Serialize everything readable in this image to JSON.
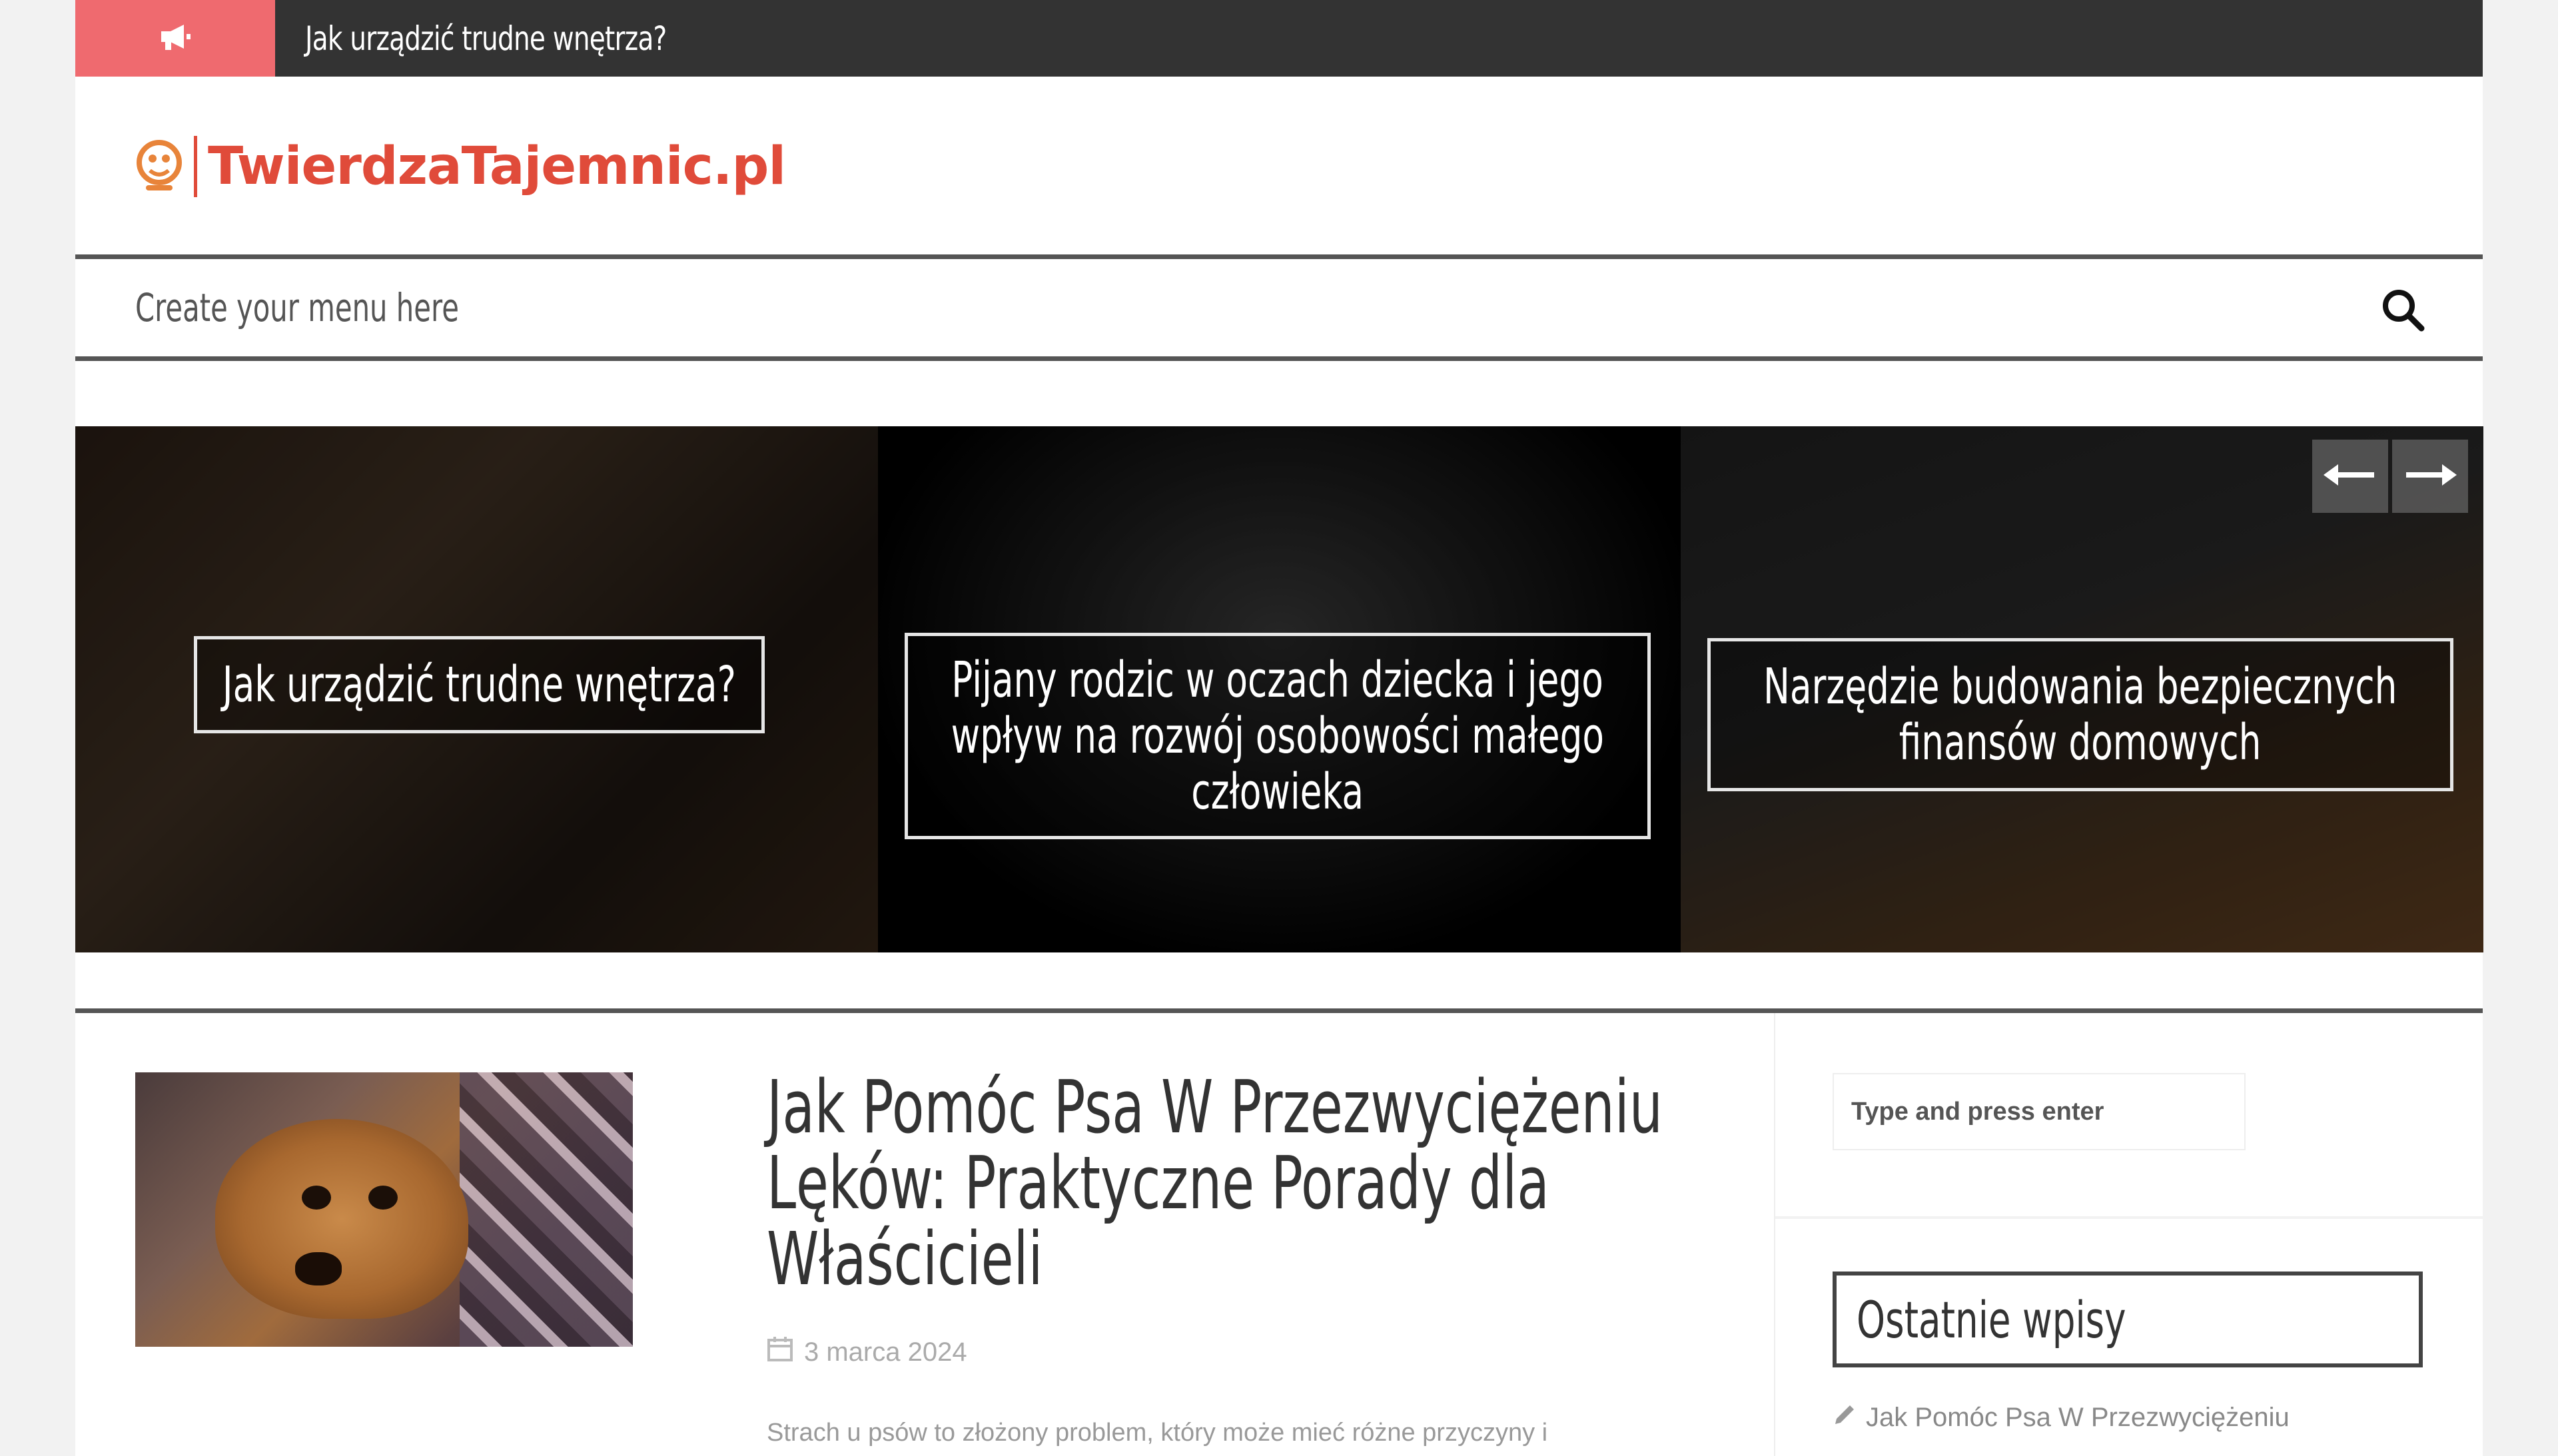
{
  "topbar": {
    "headline": "Jak urządzić trudne wnętrza?"
  },
  "logo": {
    "text": "TwierdzaTajemnic.pl"
  },
  "nav": {
    "menu_text": "Create your menu here"
  },
  "slider": {
    "slides": [
      {
        "title": "Jak urządzić trudne wnętrza?"
      },
      {
        "title_lines": [
          "Pijany rodzic w oczach dziecka i jego",
          "wpływ na rozwój osobowości małego",
          "człowieka"
        ]
      },
      {
        "title_lines": [
          "Narzędzie budowania bezpiecznych",
          "finansów domowych"
        ]
      }
    ]
  },
  "article": {
    "title_lines": [
      "Jak Pomóc Psa W Przezwyciężeniu",
      "Lęków: Praktyczne Porady dla",
      "Właścicieli"
    ],
    "date": "3 marca 2024",
    "excerpt": "Strach u psów to złożony problem, który może mieć różne przyczyny i"
  },
  "sidebar": {
    "search_placeholder": "Type and press enter",
    "widget_title": "Ostatnie wpisy",
    "recent_posts": [
      "Jak Pomóc Psa W Przezwyciężeniu"
    ]
  },
  "colors": {
    "accent": "#ef6a6f",
    "logo": "#e04b3a",
    "topbar": "#333333"
  }
}
